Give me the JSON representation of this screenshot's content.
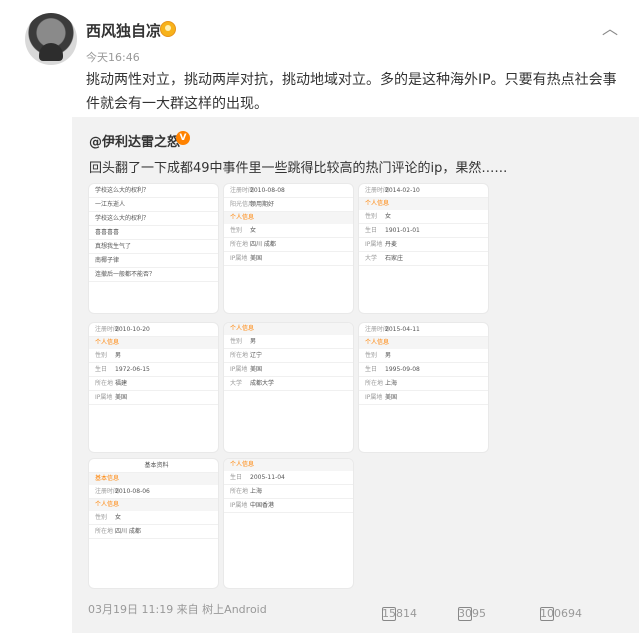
{
  "author": {
    "name": "西风独自凉",
    "time": "今天16:46"
  },
  "post": {
    "text": "挑动两性对立，挑动两岸对抗，挑动地域对立。多的是这种海外IP。只要有热点社会事件就会有一大群这样的出现。"
  },
  "quote": {
    "author": "@伊利达雷之怒",
    "text": "回头翻了一下成都49中事件里一些跳得比较高的热门评论的ip，果然……"
  },
  "footer": {
    "date": "03月19日 11:19 来自 树上Android",
    "reposts": "15814",
    "comments": "3095",
    "likes": "100694"
  },
  "thumbs": {
    "t2": {
      "date": "2010-08-08",
      "level": "领用期好",
      "gender": "女",
      "loc": "四川 成都",
      "ip": "美国"
    },
    "t3": {
      "date": "2014-02-10",
      "gender": "女",
      "birth": "1901-01-01",
      "school": "石家庄",
      "ip": "丹麦"
    },
    "t4": {
      "date": "2010-10-20",
      "gender": "男",
      "birth": "1972-06-15",
      "loc": "福建",
      "ip": "美国"
    },
    "t5": {
      "gender": "男",
      "loc": "辽宁",
      "ip": "美国",
      "school": "成都大学"
    },
    "t6": {
      "date": "2015-04-11",
      "gender": "男",
      "birth": "1995-09-08",
      "loc": "上海",
      "ip": "美国"
    },
    "t7": {
      "title": "基本资料",
      "date": "2010-08-06",
      "gender": "女",
      "loc": "四川 成都"
    },
    "t8": {
      "birth": "2005-11-04",
      "loc": "上海",
      "ip": "中国香港"
    }
  }
}
